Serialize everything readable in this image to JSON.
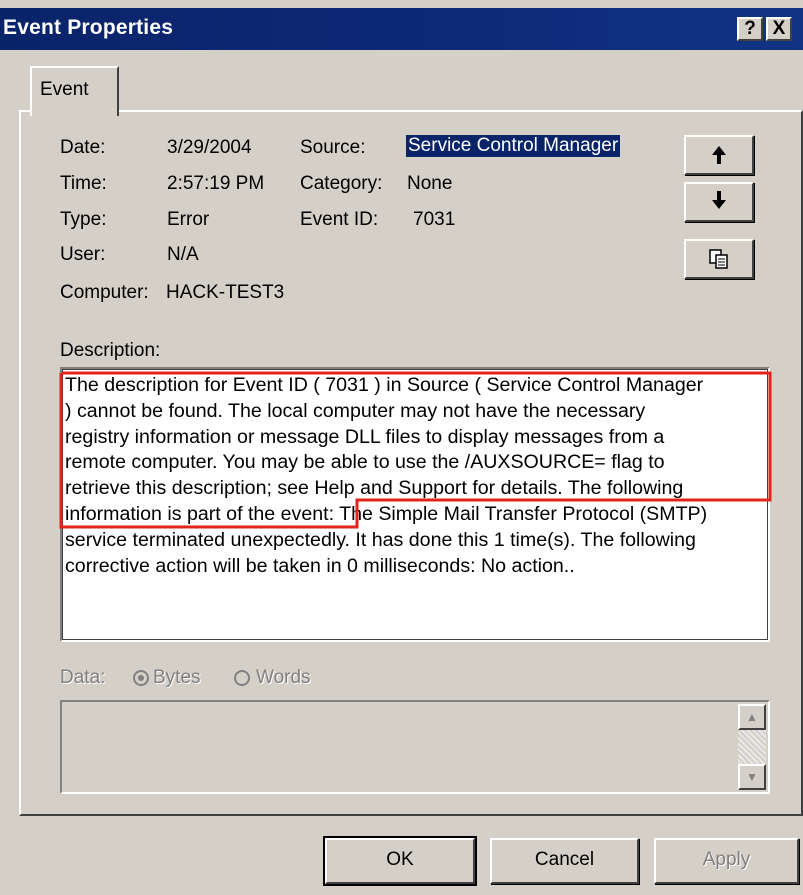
{
  "window": {
    "title": "Event Properties",
    "help_label": "?",
    "close_label": "X"
  },
  "tabs": [
    {
      "label": "Event"
    }
  ],
  "fields": {
    "date_label": "Date:",
    "date_value": "3/29/2004",
    "time_label": "Time:",
    "time_value": "2:57:19 PM",
    "type_label": "Type:",
    "type_value": "Error",
    "user_label": "User:",
    "user_value": "N/A",
    "computer_label": "Computer:",
    "computer_value": "HACK-TEST3",
    "source_label": "Source:",
    "source_value": "Service Control Manager",
    "category_label": "Category:",
    "category_value": "None",
    "eventid_label": "Event ID:",
    "eventid_value": "7031"
  },
  "nav": {
    "up_icon": "arrow-up-icon",
    "up_glyph": "🡑",
    "down_icon": "arrow-down-icon",
    "down_glyph": "🡓",
    "copy_icon": "copy-icon"
  },
  "description": {
    "label": "Description:",
    "lines": [
      "The description for Event ID ( 7031 ) in Source ( Service Control Manager",
      ") cannot be found. The local computer may not have the necessary",
      "registry information or message DLL files to display messages from a",
      "remote computer. You may be able to use the /AUXSOURCE= flag to",
      "retrieve this description; see Help and Support for details. The following",
      "information is part of the event: ",
      "The Simple Mail Transfer Protocol (SMTP)",
      "service terminated unexpectedly. It has done this 1 time(s). The following",
      "corrective action will be taken in 0 milliseconds: No action.."
    ],
    "highlight_color": "#e2231a"
  },
  "data": {
    "label": "Data:",
    "bytes_label": "Bytes",
    "words_label": "Words",
    "selected": "Bytes"
  },
  "buttons": {
    "ok": "OK",
    "cancel": "Cancel",
    "apply": "Apply"
  }
}
